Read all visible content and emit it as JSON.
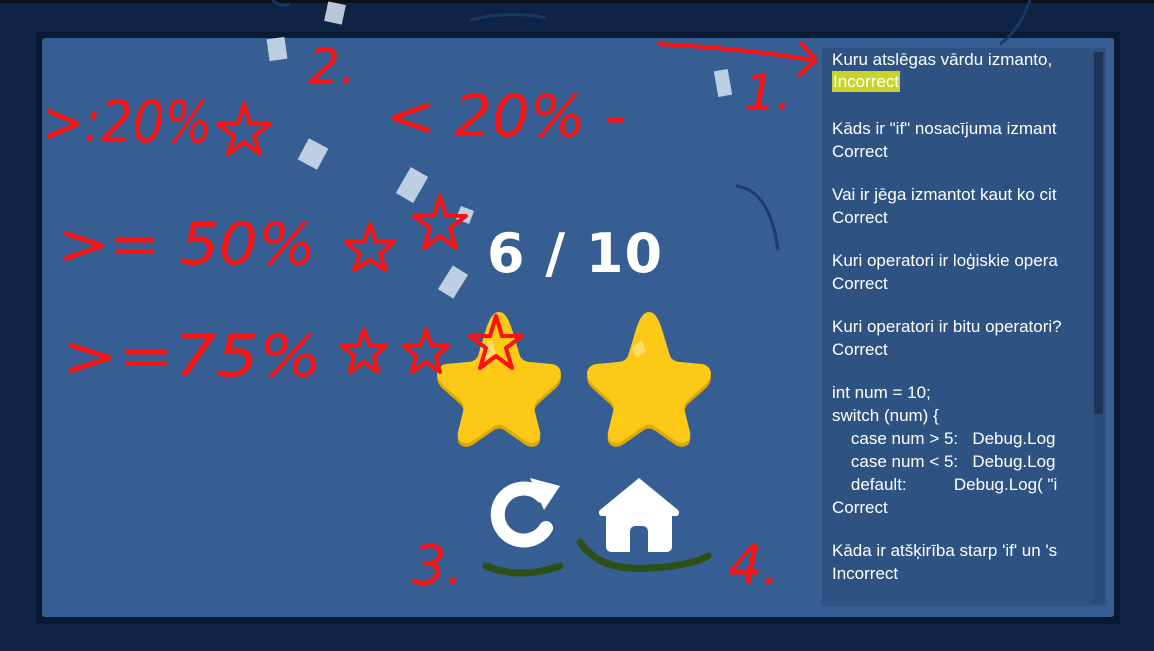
{
  "score": {
    "correct": 6,
    "total": 10,
    "text": "6 / 10"
  },
  "stars": {
    "earned": 2
  },
  "buttons": {
    "restart": "restart-button",
    "home": "home-button"
  },
  "answers_log": [
    {
      "question": "Kuru atslēgas vārdu izmanto,",
      "result": "Incorrect",
      "highlight": true
    },
    {
      "question": "Kāds ir \"if\" nosacījuma izmant",
      "result": "Correct"
    },
    {
      "question": "Vai ir jēga izmantot kaut ko cit",
      "result": "Correct"
    },
    {
      "question": "Kuri operatori ir loģiskie opera",
      "result": "Correct"
    },
    {
      "question": "Kuri operatori ir bitu operatori?",
      "result": "Correct"
    },
    {
      "code": [
        "int num = 10;",
        "switch (num) {",
        "    case num > 5:   Debug.Log",
        "    case num < 5:   Debug.Log",
        "    default:          Debug.Log( \"i"
      ],
      "result": "Correct"
    },
    {
      "question": "Kāda ir atšķirība starp 'if' un 's",
      "result": "Incorrect"
    }
  ],
  "annotations": {
    "rule_1": ">:20%",
    "rule_2": ">= 50%",
    "rule_3": ">=75%",
    "rule_less": "< 20% -",
    "label_1": "1.",
    "label_2": "2.",
    "label_3": "3.",
    "label_4": "4."
  },
  "colors": {
    "panel": "#375e93",
    "star": "#f5c518",
    "annotation_red": "#ff0000",
    "annotation_green": "#2d5016",
    "highlight": "#c9d428"
  }
}
